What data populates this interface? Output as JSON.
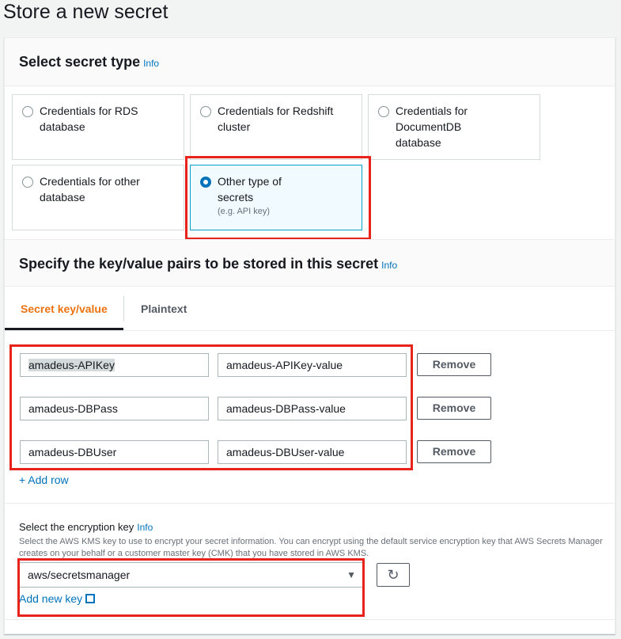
{
  "page_title": "Store a new secret",
  "secret_type": {
    "heading": "Select secret type",
    "info": "Info",
    "tiles": [
      {
        "label": "Credentials for RDS database"
      },
      {
        "label": "Credentials for Redshift cluster"
      },
      {
        "label": "Credentials for DocumentDB database"
      },
      {
        "label": "Credentials for other database"
      },
      {
        "label": "Other type of secrets",
        "sub": "(e.g. API key)",
        "selected": true
      }
    ]
  },
  "kv_section": {
    "heading": "Specify the key/value pairs to be stored in this secret",
    "info": "Info",
    "tabs": [
      "Secret key/value",
      "Plaintext"
    ],
    "rows": [
      {
        "key": "amadeus-APIKey",
        "value": "amadeus-APIKey-value"
      },
      {
        "key": "amadeus-DBPass",
        "value": "amadeus-DBPass-value"
      },
      {
        "key": "amadeus-DBUser",
        "value": "amadeus-DBUser-value"
      }
    ],
    "remove_label": "Remove",
    "add_row": "+ Add row"
  },
  "encryption": {
    "label": "Select the encryption key",
    "info": "Info",
    "description": "Select the AWS KMS key to use to encrypt your secret information. You can encrypt using the default service encryption key that AWS Secrets Manager creates on your behalf or a customer master key (CMK) that you have stored in AWS KMS.",
    "selected": "aws/secretsmanager",
    "add_new_key": "Add new key"
  },
  "colors": {
    "accent": "#ec7211",
    "link": "#0073bb",
    "highlight": "#e8231c"
  }
}
